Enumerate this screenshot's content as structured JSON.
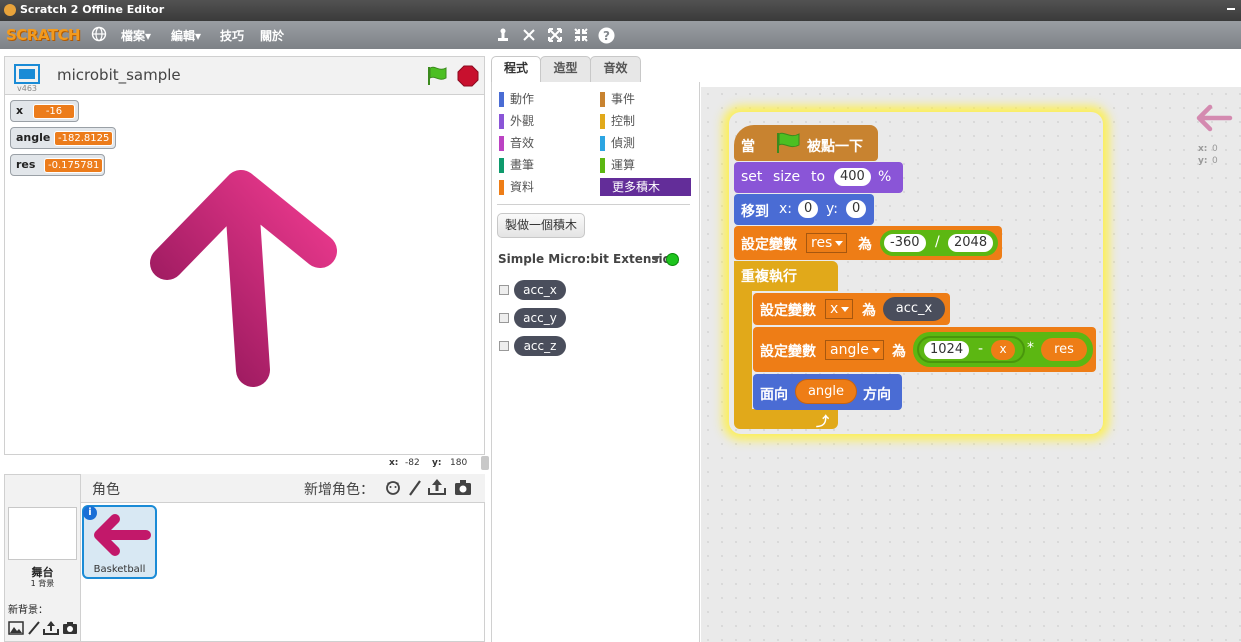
{
  "window": {
    "title": "Scratch 2 Offline Editor"
  },
  "menubar": {
    "logo": "SCRATCH",
    "items": [
      "檔案▾",
      "編輯▾",
      "技巧",
      "關於"
    ]
  },
  "stage": {
    "project_title": "microbit_sample",
    "version": "v463",
    "monitors": [
      {
        "label": "x",
        "value": "-16"
      },
      {
        "label": "angle",
        "value": "-182.8125"
      },
      {
        "label": "res",
        "value": "-0.175781"
      }
    ],
    "coords": {
      "x_label": "x:",
      "x": "-82",
      "y_label": "y:",
      "y": "180"
    }
  },
  "sprites_panel": {
    "stage_label": "舞台",
    "backdrop_count": "1 背景",
    "new_backdrop": "新背景：",
    "header": "角色",
    "new_sprite": "新增角色：",
    "sprites": [
      {
        "name": "Basketball"
      }
    ]
  },
  "tabs": [
    "程式",
    "造型",
    "音效"
  ],
  "palette": {
    "categories": [
      {
        "label": "動作",
        "color": "#4a6cd4"
      },
      {
        "label": "事件",
        "color": "#c88330"
      },
      {
        "label": "外觀",
        "color": "#8a55d7"
      },
      {
        "label": "控制",
        "color": "#e1a91a"
      },
      {
        "label": "音效",
        "color": "#bb42c3"
      },
      {
        "label": "偵測",
        "color": "#2ca5e2"
      },
      {
        "label": "畫筆",
        "color": "#0e9a6c"
      },
      {
        "label": "運算",
        "color": "#5cb712"
      },
      {
        "label": "資料",
        "color": "#ee7d16"
      },
      {
        "label": "更多積木",
        "color": "#632d99"
      }
    ],
    "make_block_button": "製做一個積木",
    "extension_name": "Simple Micro:bit Extension",
    "reporters": [
      "acc_x",
      "acc_y",
      "acc_z"
    ]
  },
  "script": {
    "hat": {
      "prefix": "當",
      "suffix": "被點一下"
    },
    "set_size": {
      "w1": "set",
      "w2": "size",
      "w3": "to",
      "value": "400",
      "unit": "%"
    },
    "goto": {
      "label": "移到",
      "x_label": "x:",
      "x": "0",
      "y_label": "y:",
      "y": "0"
    },
    "set_res": {
      "label": "設定變數",
      "var": "res",
      "as": "為",
      "num1": "-360",
      "op": "/",
      "num2": "2048"
    },
    "forever": {
      "label": "重複執行"
    },
    "set_x": {
      "label": "設定變數",
      "var": "x",
      "as": "為",
      "reporter": "acc_x"
    },
    "set_angle": {
      "label": "設定變數",
      "var": "angle",
      "as": "為",
      "num": "1024",
      "minus": "-",
      "var_x": "x",
      "times": "*",
      "var_res": "res"
    },
    "point": {
      "label": "面向",
      "var": "angle",
      "suffix": "方向"
    }
  },
  "sprite_info": {
    "x_label": "x:",
    "x": "0",
    "y_label": "y:",
    "y": "0"
  }
}
